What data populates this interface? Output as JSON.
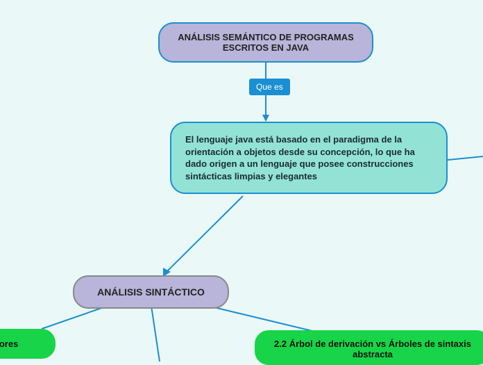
{
  "nodes": {
    "title": "ANÁLISIS SEMÁNTICO DE PROGRAMAS ESCRITOS EN JAVA",
    "edge_label_1": "Que es",
    "description": "El lenguaje java está basado en el paradigma de la orientación a objetos desde su concepción, lo que ha dado origen a un lenguaje que posee construcciones sintácticas limpias y elegantes",
    "analysis": "ANÁLISIS SINTÁCTICO",
    "adores": "adores",
    "arbol": "2.2 Árbol de derivación vs Árboles de sintaxis abstracta"
  }
}
